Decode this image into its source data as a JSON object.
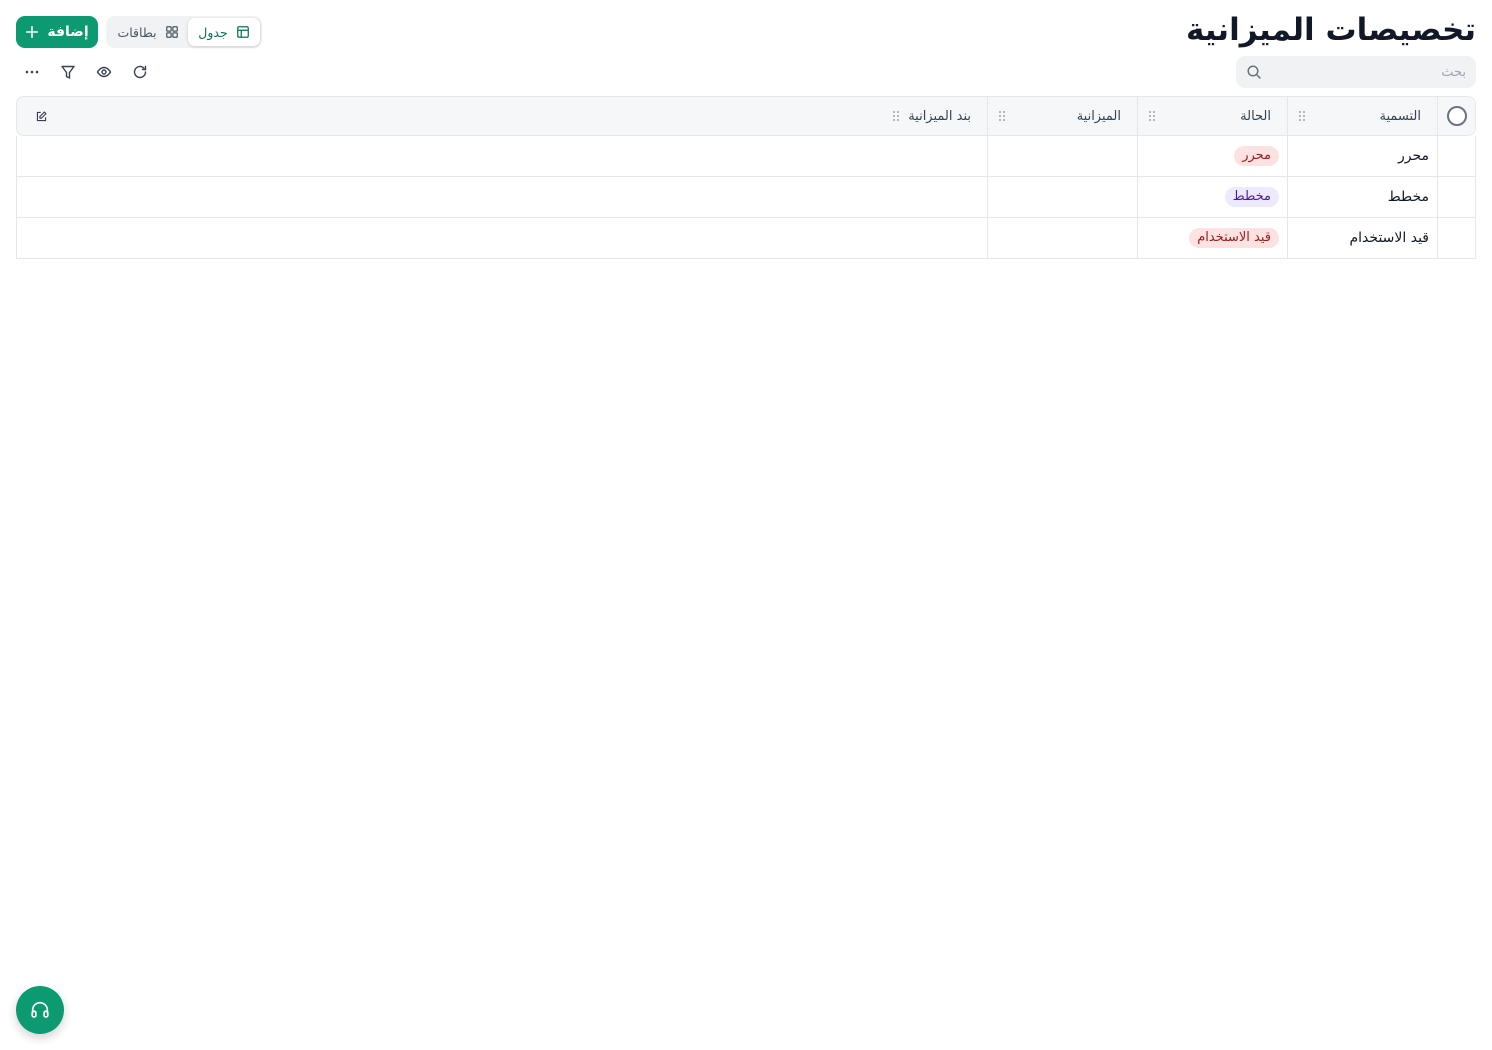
{
  "header": {
    "title": "تخصيصات الميزانية",
    "add_label": "إضافة"
  },
  "view_toggle": {
    "table_label": "جدول",
    "cards_label": "بطاقات",
    "active": "table"
  },
  "search": {
    "placeholder": "بحث",
    "value": ""
  },
  "toolbar": {
    "icons": [
      "refresh-icon",
      "eye-icon",
      "filter-icon",
      "more-icon"
    ]
  },
  "table": {
    "columns": [
      "التسمية",
      "الحالة",
      "الميزانية",
      "بند الميزانية"
    ],
    "rows": [
      {
        "name": "محرر",
        "status": "محرر",
        "status_bg": "#fde2e2",
        "status_fg": "#9b1c1c",
        "budget": "",
        "item": ""
      },
      {
        "name": "مخطط",
        "status": "مخطط",
        "status_bg": "#ede9fe",
        "status_fg": "#4c1d95",
        "budget": "",
        "item": ""
      },
      {
        "name": "قيد الاستخدام",
        "status": "قيد الاستخدام",
        "status_bg": "#fde2e2",
        "status_fg": "#9b1c1c",
        "budget": "",
        "item": ""
      }
    ]
  },
  "colors": {
    "accent": "#0c9a72",
    "active_toggle_text": "#0c6e53"
  }
}
